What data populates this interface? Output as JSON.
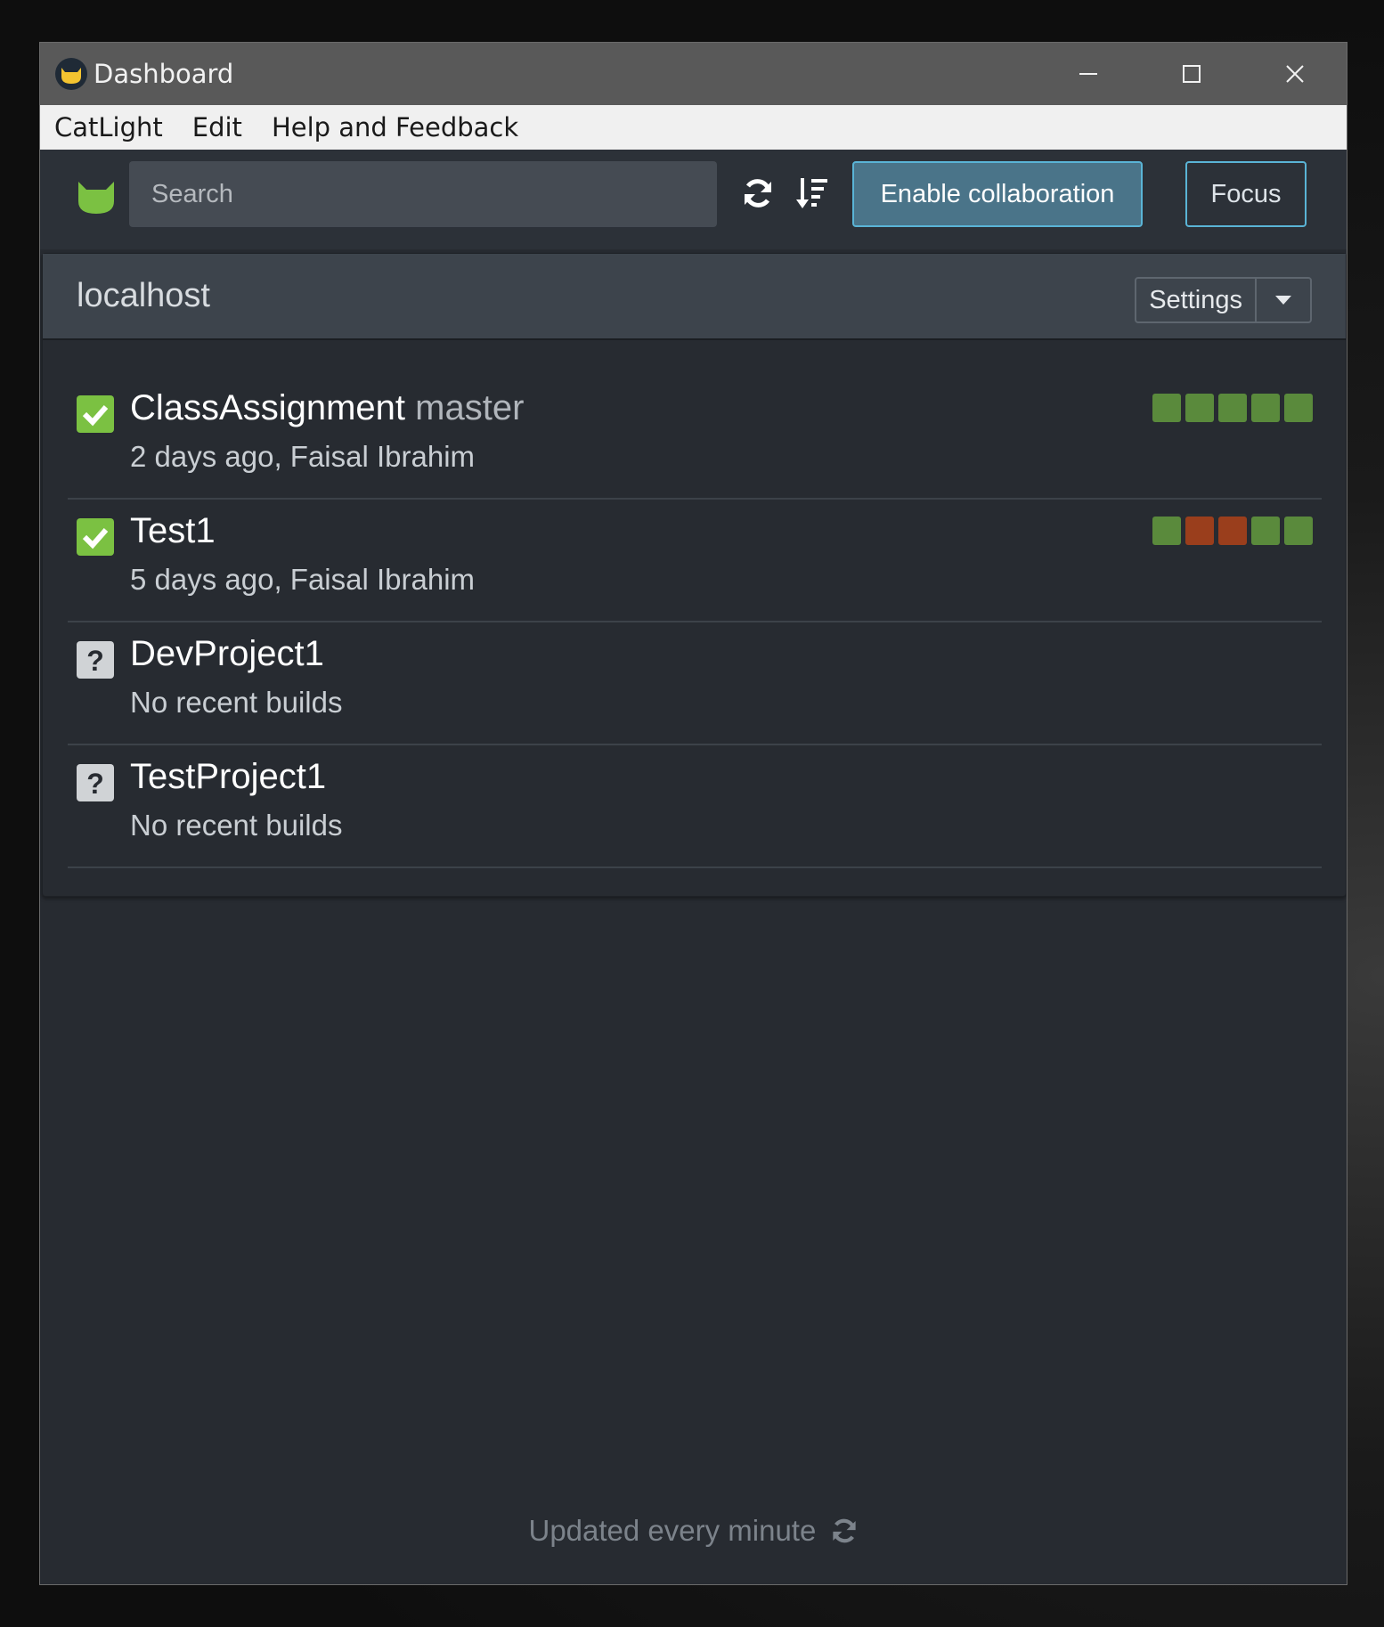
{
  "window": {
    "title": "Dashboard"
  },
  "menu": {
    "items": [
      "CatLight",
      "Edit",
      "Help and Feedback"
    ]
  },
  "toolbar": {
    "search_placeholder": "Search",
    "collab_label": "Enable collaboration",
    "focus_label": "Focus"
  },
  "panel": {
    "title": "localhost",
    "settings_label": "Settings",
    "projects": [
      {
        "name": "ClassAssignment",
        "branch": "master",
        "subtitle": "2 days ago, Faisal Ibrahim",
        "status": "success",
        "history": [
          "success",
          "success",
          "success",
          "success",
          "success"
        ]
      },
      {
        "name": "Test1",
        "branch": "",
        "subtitle": "5 days ago, Faisal Ibrahim",
        "status": "success",
        "history": [
          "success",
          "failed",
          "failed",
          "success",
          "success"
        ]
      },
      {
        "name": "DevProject1",
        "branch": "",
        "subtitle": "No recent builds",
        "status": "unknown",
        "history": []
      },
      {
        "name": "TestProject1",
        "branch": "",
        "subtitle": "No recent builds",
        "status": "unknown",
        "history": []
      }
    ]
  },
  "footer": {
    "text": "Updated every minute"
  },
  "colors": {
    "success": "#5a8a3c",
    "failed": "#9a3e1c",
    "accent": "#5ab4d6",
    "check_green": "#7bc142"
  }
}
